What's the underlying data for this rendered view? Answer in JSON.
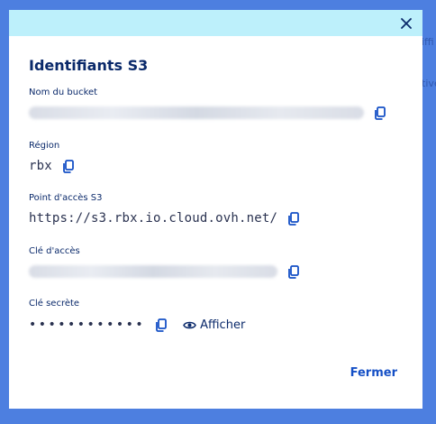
{
  "backdrop": {
    "text1": "iffi",
    "text2": "tive"
  },
  "modal": {
    "title": "Identifiants S3",
    "bucket_label": "Nom du bucket",
    "region_label": "Région",
    "region_value": "rbx",
    "endpoint_label": "Point d'accès S3",
    "endpoint_value": "https://s3.rbx.io.cloud.ovh.net/",
    "access_key_label": "Clé d'accès",
    "secret_key_label": "Clé secrète",
    "secret_mask": "••••••••••••",
    "show_label": "Afficher",
    "close_label": "Fermer"
  },
  "icons": {
    "close": "close-icon",
    "copy": "copy-icon",
    "eye": "eye-icon"
  },
  "colors": {
    "backdrop": "#4d7fe0",
    "header": "#bdf0fb",
    "title": "#0b2a6b",
    "accent": "#1550c6"
  }
}
